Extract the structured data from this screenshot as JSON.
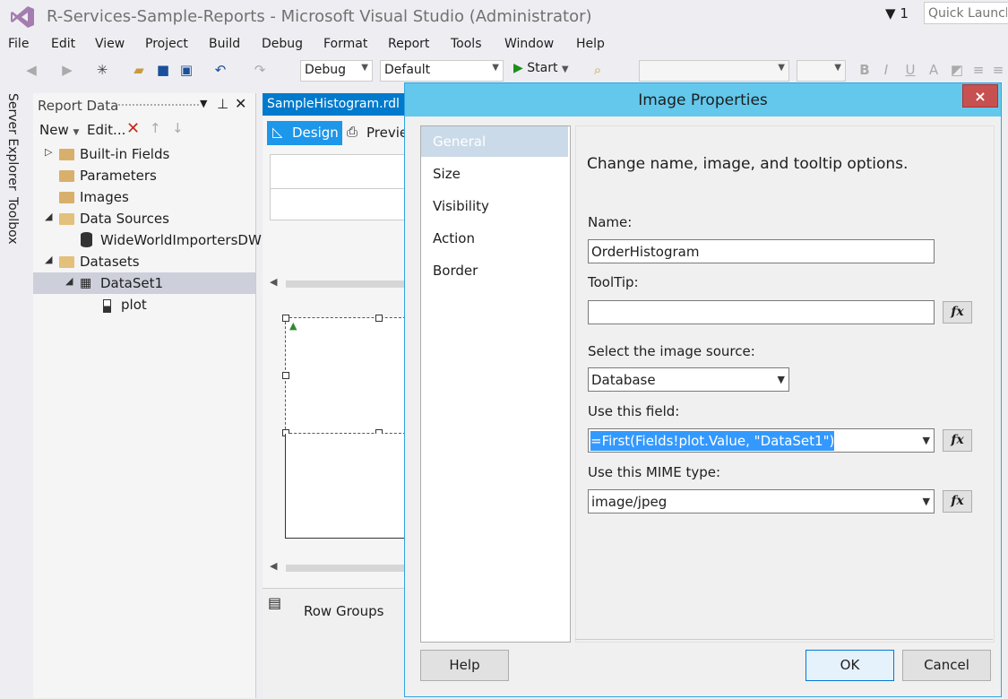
{
  "window": {
    "title": "R-Services-Sample-Reports - Microsoft Visual Studio (Administrator)",
    "notification_count": "1",
    "quick_launch_placeholder": "Quick Launch"
  },
  "menu": [
    "File",
    "Edit",
    "View",
    "Project",
    "Build",
    "Debug",
    "Format",
    "Report",
    "Tools",
    "Window",
    "Help"
  ],
  "toolbar": {
    "config": "Debug",
    "platform": "Default",
    "start_label": "Start"
  },
  "side_tabs": [
    "Server Explorer",
    "Toolbox"
  ],
  "report_data": {
    "title": "Report Data",
    "new_label": "New",
    "edit_label": "Edit...",
    "tree": [
      {
        "label": "Built-in Fields"
      },
      {
        "label": "Parameters"
      },
      {
        "label": "Images"
      },
      {
        "label": "Data Sources"
      },
      {
        "label": "WideWorldImportersDW"
      },
      {
        "label": "Datasets"
      },
      {
        "label": "DataSet1"
      },
      {
        "label": "plot"
      }
    ]
  },
  "designer": {
    "doc_tab": "SampleHistogram.rdl [",
    "design_label": "Design",
    "preview_label": "Preview",
    "row_groups": "Row Groups"
  },
  "dialog": {
    "title": "Image Properties",
    "close": "×",
    "nav": [
      "General",
      "Size",
      "Visibility",
      "Action",
      "Border"
    ],
    "heading": "Change name, image, and tooltip options.",
    "name_label": "Name:",
    "name_value": "OrderHistogram",
    "tooltip_label": "ToolTip:",
    "tooltip_value": "",
    "source_label": "Select the image source:",
    "source_value": "Database",
    "field_label": "Use this field:",
    "field_value": "=First(Fields!plot.Value, \"DataSet1\")",
    "mime_label": "Use this MIME type:",
    "mime_value": "image/jpeg",
    "fx": "fx",
    "help_label": "Help",
    "ok_label": "OK",
    "cancel_label": "Cancel"
  },
  "colors": {
    "accent": "#007acc",
    "dialog_title_bg": "#63c8ec",
    "close_red": "#c75050",
    "selection": "#3399ff",
    "folder": "#d8b06b"
  }
}
